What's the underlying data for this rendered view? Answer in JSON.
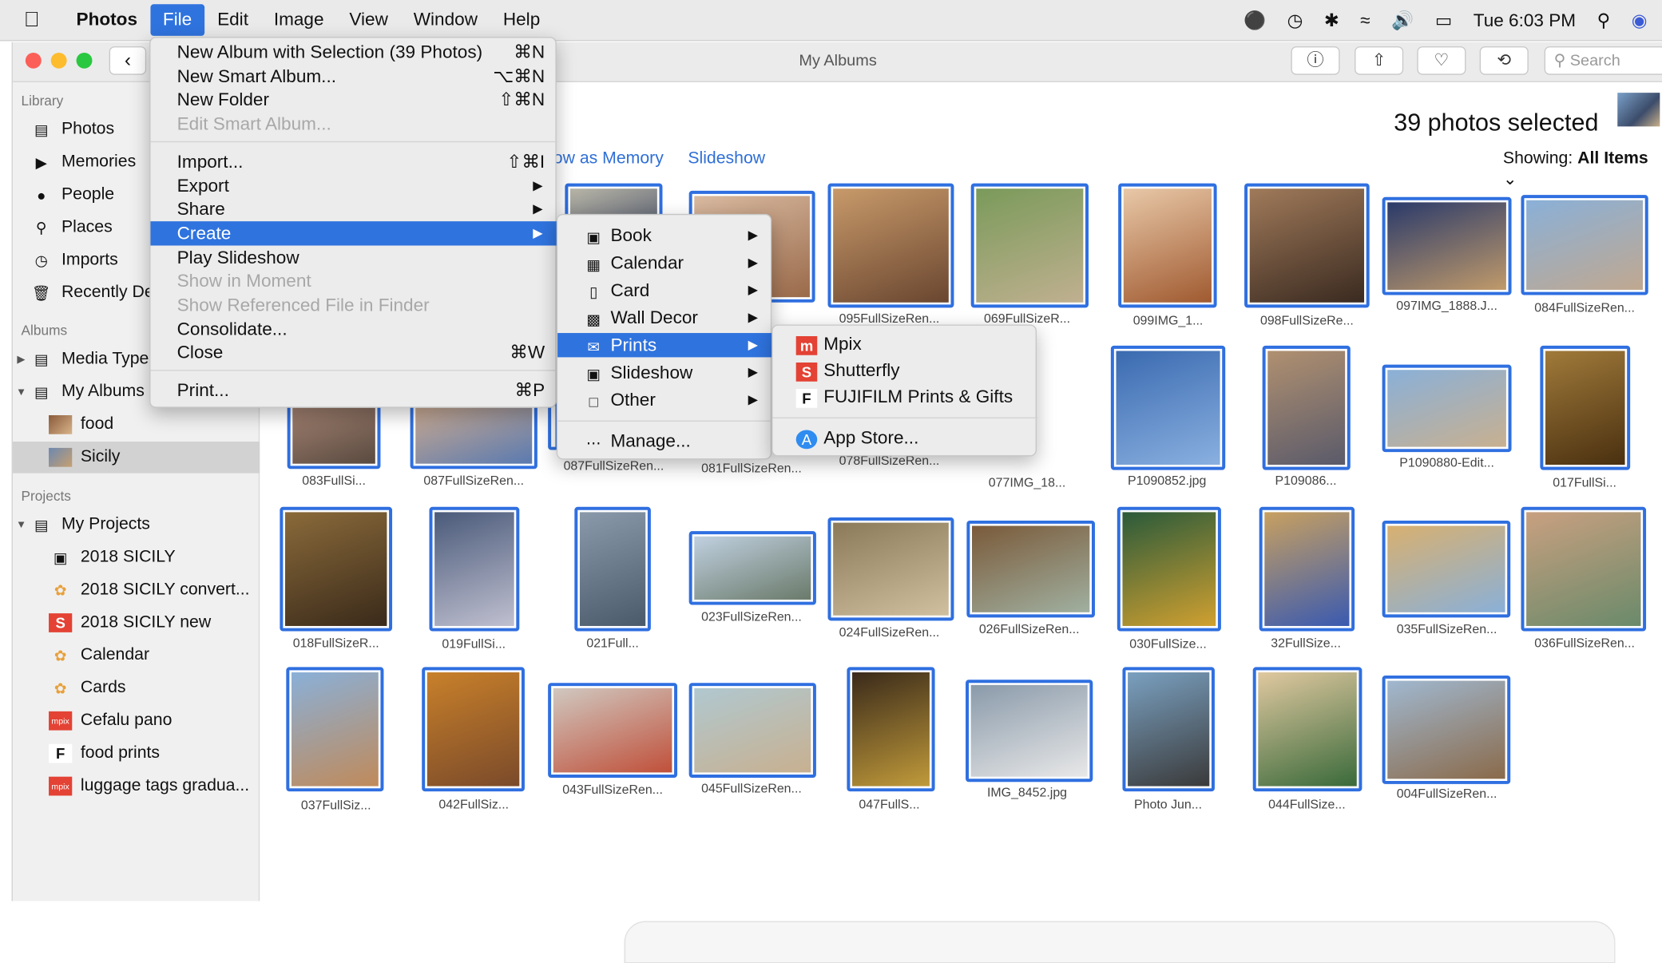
{
  "menubar": {
    "app": "Photos",
    "items": [
      "File",
      "Edit",
      "Image",
      "View",
      "Window",
      "Help"
    ],
    "clock": "Tue 6:03 PM"
  },
  "window": {
    "title": "My Albums",
    "search_placeholder": "Search"
  },
  "sidebar": {
    "library_header": "Library",
    "library": [
      "Photos",
      "Memories",
      "People",
      "Places",
      "Imports",
      "Recently De"
    ],
    "albums_header": "Albums",
    "albums": [
      "Media Type",
      "My Albums",
      "food",
      "Sicily"
    ],
    "projects_header": "Projects",
    "projects": [
      "My Projects",
      "2018 SICILY",
      "2018 SICILY convert...",
      "2018 SICILY new",
      "Calendar",
      "Cards",
      "Cefalu pano",
      "food prints",
      "luggage tags gradua..."
    ]
  },
  "main": {
    "selected_count": "39 photos selected",
    "show_as_memory": "ow as Memory",
    "slideshow": "Slideshow",
    "showing_label": "Showing:",
    "showing_value": "All Items"
  },
  "file_menu": [
    {
      "label": "New Album with Selection (39 Photos)",
      "shortcut": "⌘N"
    },
    {
      "label": "New Smart Album...",
      "shortcut": "⌥⌘N"
    },
    {
      "label": "New Folder",
      "shortcut": "⇧⌘N"
    },
    {
      "label": "Edit Smart Album...",
      "shortcut": ""
    },
    {
      "label": "Import...",
      "shortcut": "⇧⌘I"
    },
    {
      "label": "Export",
      "shortcut": ""
    },
    {
      "label": "Share",
      "shortcut": ""
    },
    {
      "label": "Create",
      "shortcut": ""
    },
    {
      "label": "Play Slideshow",
      "shortcut": ""
    },
    {
      "label": "Show in Moment",
      "shortcut": ""
    },
    {
      "label": "Show Referenced File in Finder",
      "shortcut": ""
    },
    {
      "label": "Consolidate...",
      "shortcut": ""
    },
    {
      "label": "Close",
      "shortcut": "⌘W"
    },
    {
      "label": "Print...",
      "shortcut": "⌘P"
    }
  ],
  "create_menu": [
    "Book",
    "Calendar",
    "Card",
    "Wall Decor",
    "Prints",
    "Slideshow",
    "Other",
    "Manage..."
  ],
  "prints_menu": [
    "Mpix",
    "Shutterfly",
    "FUJIFILM Prints & Gifts",
    "App Store..."
  ],
  "captions": [
    "095FullSizeRen...",
    "069FullSizeR...",
    "099IMG_1...",
    "098FullSizeRe...",
    "097IMG_1888.J...",
    "084FullSizeRen...",
    "083FullSi...",
    "087FullSizeRen...",
    "087FullSizeRen...",
    "081FullSizeRen...",
    "078FullSizeRen...",
    "077IMG_18...",
    "P1090852.jpg",
    "P109086...",
    "P1090880-Edit...",
    "017FullSi...",
    "018FullSizeR...",
    "019FullSi...",
    "021Full...",
    "023FullSizeRen...",
    "024FullSizeRen...",
    "026FullSizeRen...",
    "030FullSize...",
    "32FullSize...",
    "035FullSizeRen...",
    "036FullSizeRen...",
    "037FullSiz...",
    "042FullSiz...",
    "043FullSizeRen...",
    "045FullSizeRen...",
    "047FullS...",
    "IMG_8452.jpg",
    "Photo Jun...",
    "044FullSize...",
    "004FullSizeRen..."
  ],
  "colors": {
    "accent": "#2f73de",
    "selection": "#2f6fe0"
  }
}
